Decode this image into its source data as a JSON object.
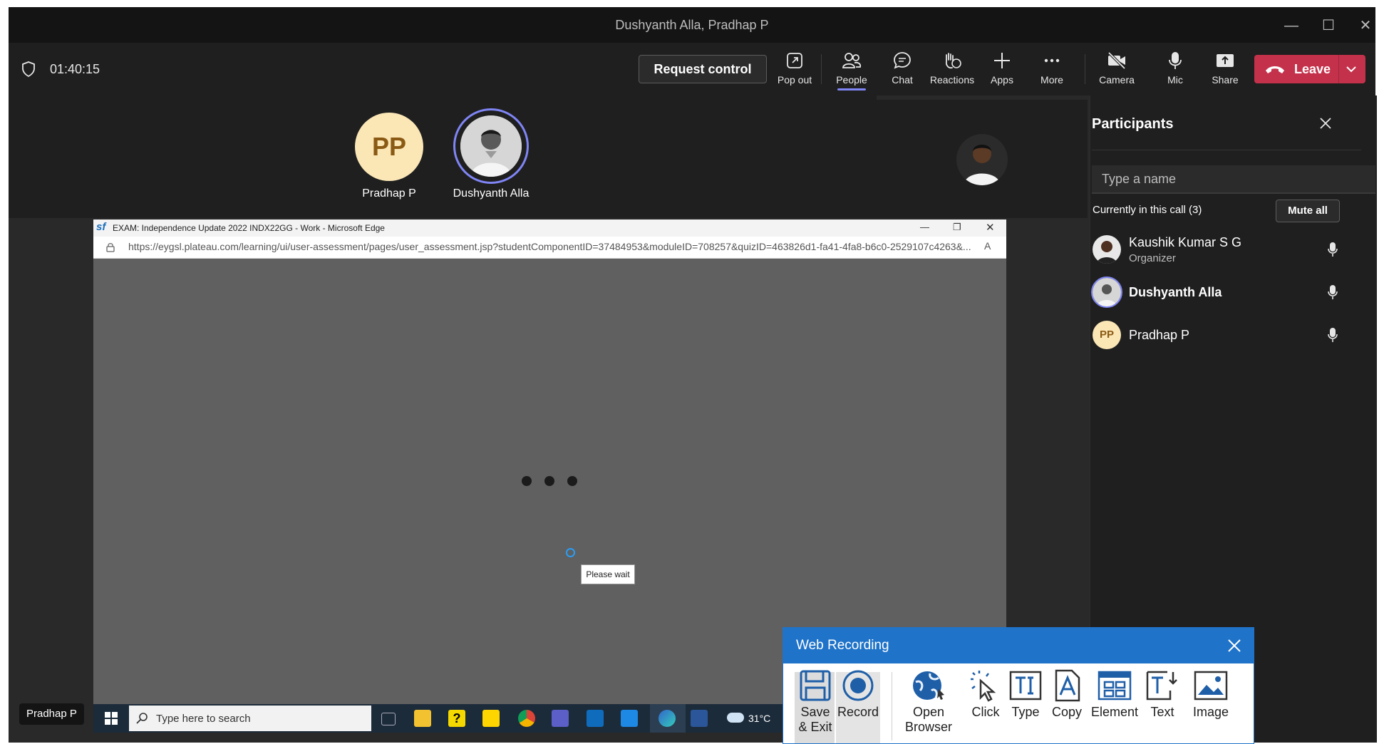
{
  "window": {
    "title": "Dushyanth Alla, Pradhap P"
  },
  "meeting": {
    "timer": "01:40:15"
  },
  "toolbar": {
    "request_control": "Request control",
    "pop_out": "Pop out",
    "people": "People",
    "chat": "Chat",
    "reactions": "Reactions",
    "apps": "Apps",
    "more": "More",
    "camera": "Camera",
    "mic": "Mic",
    "share": "Share",
    "leave": "Leave"
  },
  "stage": {
    "tiles": [
      {
        "name": "Pradhap P",
        "initials": "PP"
      },
      {
        "name": "Dushyanth Alla"
      }
    ],
    "presenter_label": "Pradhap P"
  },
  "edge": {
    "title": "EXAM: Independence Update 2022 INDX22GG - Work - Microsoft Edge",
    "favicon_text": "sf",
    "url": "https://eygsl.plateau.com/learning/ui/user-assessment/pages/user_assessment.jsp?studentComponentID=37484953&moduleID=708257&quizID=463826d1-fa41-4fa8-b6c0-2529107c4263&...",
    "please_wait": "Please wait"
  },
  "taskbar": {
    "search_placeholder": "Type here to search",
    "weather": "31°C"
  },
  "participants": {
    "title": "Participants",
    "search_placeholder": "Type a name",
    "section": "Currently in this call (3)",
    "mute_all": "Mute all",
    "list": [
      {
        "name": "Kaushik Kumar S G",
        "role": "Organizer"
      },
      {
        "name": "Dushyanth Alla"
      },
      {
        "name": "Pradhap P",
        "initials": "PP"
      }
    ]
  },
  "web_recording": {
    "title": "Web Recording",
    "buttons": {
      "save_line1": "Save",
      "save_line2": "& Exit",
      "record": "Record",
      "open_line1": "Open",
      "open_line2": "Browser",
      "click": "Click",
      "type": "Type",
      "copy": "Copy",
      "element": "Element",
      "text": "Text",
      "image": "Image"
    }
  },
  "colors": {
    "accent": "#7f85f5",
    "leave": "#c4314b",
    "recording_blue": "#1f73c9"
  }
}
